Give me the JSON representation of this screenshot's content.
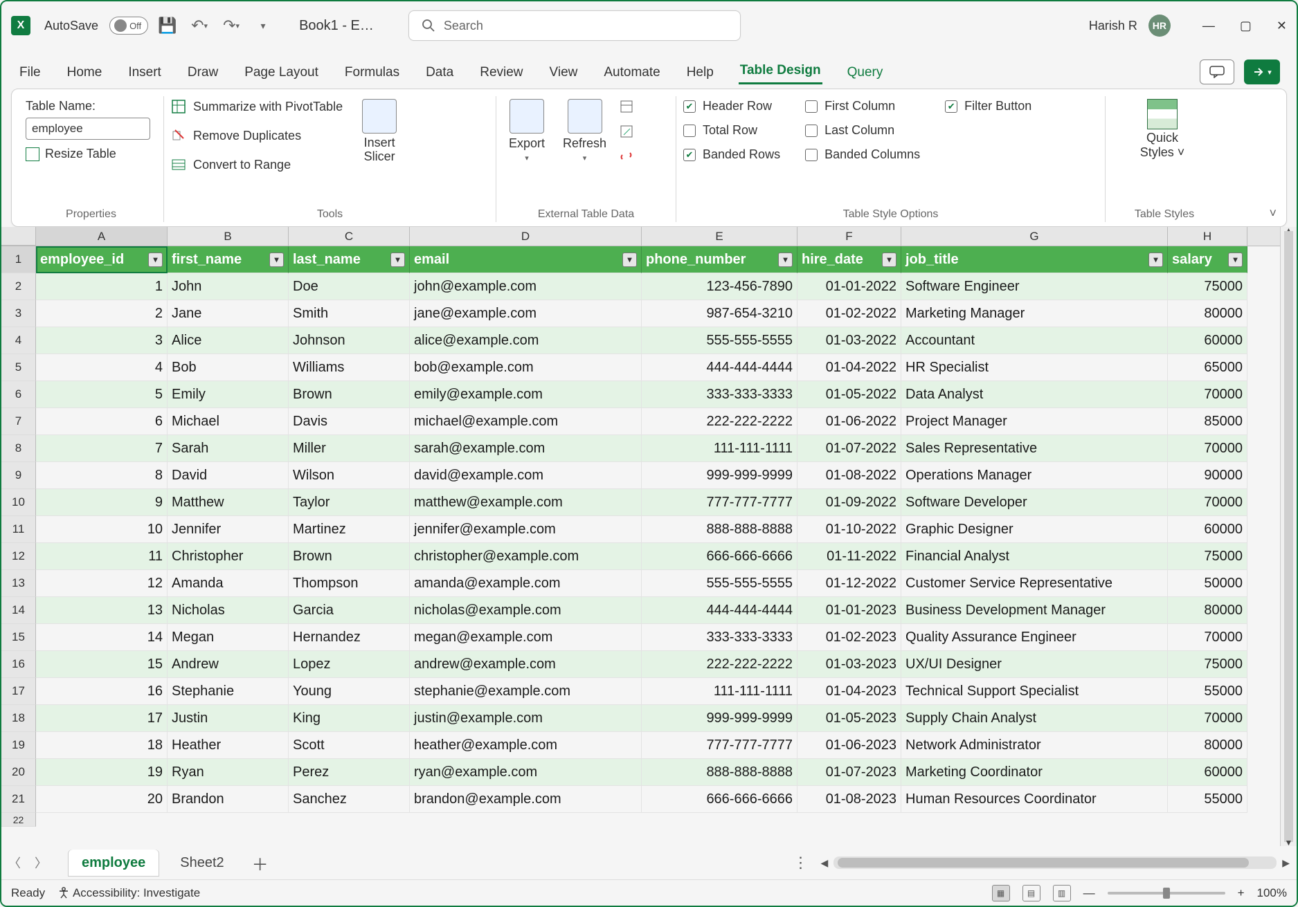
{
  "titlebar": {
    "autosave_label": "AutoSave",
    "autosave_state": "Off",
    "book_title": "Book1  -  E…",
    "search_placeholder": "Search",
    "user_name": "Harish R",
    "user_initials": "HR"
  },
  "tabs": {
    "items": [
      "File",
      "Home",
      "Insert",
      "Draw",
      "Page Layout",
      "Formulas",
      "Data",
      "Review",
      "View",
      "Automate",
      "Help",
      "Table Design",
      "Query"
    ],
    "active": "Table Design"
  },
  "ribbon": {
    "properties": {
      "table_name_label": "Table Name:",
      "table_name_value": "employee",
      "resize_table": "Resize Table",
      "group_label": "Properties"
    },
    "tools": {
      "summarize": "Summarize with PivotTable",
      "remove_dup": "Remove Duplicates",
      "convert_range": "Convert to Range",
      "insert_slicer": "Insert Slicer",
      "group_label": "Tools"
    },
    "external": {
      "export": "Export",
      "refresh": "Refresh",
      "group_label": "External Table Data"
    },
    "style_options": {
      "header_row": "Header Row",
      "total_row": "Total Row",
      "banded_rows": "Banded Rows",
      "first_column": "First Column",
      "last_column": "Last Column",
      "banded_columns": "Banded Columns",
      "filter_button": "Filter Button",
      "group_label": "Table Style Options"
    },
    "styles": {
      "quick_styles": "Quick Styles",
      "group_label": "Table Styles"
    }
  },
  "columns": [
    "A",
    "B",
    "C",
    "D",
    "E",
    "F",
    "G",
    "H"
  ],
  "table_headers": [
    "employee_id",
    "first_name",
    "last_name",
    "email",
    "phone_number",
    "hire_date",
    "job_title",
    "salary"
  ],
  "table_rows": [
    {
      "id": 1,
      "fn": "John",
      "ln": "Doe",
      "em": "john@example.com",
      "ph": "123-456-7890",
      "hd": "01-01-2022",
      "jt": "Software Engineer",
      "sl": 75000
    },
    {
      "id": 2,
      "fn": "Jane",
      "ln": "Smith",
      "em": "jane@example.com",
      "ph": "987-654-3210",
      "hd": "01-02-2022",
      "jt": "Marketing Manager",
      "sl": 80000
    },
    {
      "id": 3,
      "fn": "Alice",
      "ln": "Johnson",
      "em": "alice@example.com",
      "ph": "555-555-5555",
      "hd": "01-03-2022",
      "jt": "Accountant",
      "sl": 60000
    },
    {
      "id": 4,
      "fn": "Bob",
      "ln": "Williams",
      "em": "bob@example.com",
      "ph": "444-444-4444",
      "hd": "01-04-2022",
      "jt": "HR Specialist",
      "sl": 65000
    },
    {
      "id": 5,
      "fn": "Emily",
      "ln": "Brown",
      "em": "emily@example.com",
      "ph": "333-333-3333",
      "hd": "01-05-2022",
      "jt": "Data Analyst",
      "sl": 70000
    },
    {
      "id": 6,
      "fn": "Michael",
      "ln": "Davis",
      "em": "michael@example.com",
      "ph": "222-222-2222",
      "hd": "01-06-2022",
      "jt": "Project Manager",
      "sl": 85000
    },
    {
      "id": 7,
      "fn": "Sarah",
      "ln": "Miller",
      "em": "sarah@example.com",
      "ph": "111-111-1111",
      "hd": "01-07-2022",
      "jt": "Sales Representative",
      "sl": 70000
    },
    {
      "id": 8,
      "fn": "David",
      "ln": "Wilson",
      "em": "david@example.com",
      "ph": "999-999-9999",
      "hd": "01-08-2022",
      "jt": "Operations Manager",
      "sl": 90000
    },
    {
      "id": 9,
      "fn": "Matthew",
      "ln": "Taylor",
      "em": "matthew@example.com",
      "ph": "777-777-7777",
      "hd": "01-09-2022",
      "jt": "Software Developer",
      "sl": 70000
    },
    {
      "id": 10,
      "fn": "Jennifer",
      "ln": "Martinez",
      "em": "jennifer@example.com",
      "ph": "888-888-8888",
      "hd": "01-10-2022",
      "jt": "Graphic Designer",
      "sl": 60000
    },
    {
      "id": 11,
      "fn": "Christopher",
      "ln": "Brown",
      "em": "christopher@example.com",
      "ph": "666-666-6666",
      "hd": "01-11-2022",
      "jt": "Financial Analyst",
      "sl": 75000
    },
    {
      "id": 12,
      "fn": "Amanda",
      "ln": "Thompson",
      "em": "amanda@example.com",
      "ph": "555-555-5555",
      "hd": "01-12-2022",
      "jt": "Customer Service Representative",
      "sl": 50000
    },
    {
      "id": 13,
      "fn": "Nicholas",
      "ln": "Garcia",
      "em": "nicholas@example.com",
      "ph": "444-444-4444",
      "hd": "01-01-2023",
      "jt": "Business Development Manager",
      "sl": 80000
    },
    {
      "id": 14,
      "fn": "Megan",
      "ln": "Hernandez",
      "em": "megan@example.com",
      "ph": "333-333-3333",
      "hd": "01-02-2023",
      "jt": "Quality Assurance Engineer",
      "sl": 70000
    },
    {
      "id": 15,
      "fn": "Andrew",
      "ln": "Lopez",
      "em": "andrew@example.com",
      "ph": "222-222-2222",
      "hd": "01-03-2023",
      "jt": "UX/UI Designer",
      "sl": 75000
    },
    {
      "id": 16,
      "fn": "Stephanie",
      "ln": "Young",
      "em": "stephanie@example.com",
      "ph": "111-111-1111",
      "hd": "01-04-2023",
      "jt": "Technical Support Specialist",
      "sl": 55000
    },
    {
      "id": 17,
      "fn": "Justin",
      "ln": "King",
      "em": "justin@example.com",
      "ph": "999-999-9999",
      "hd": "01-05-2023",
      "jt": "Supply Chain Analyst",
      "sl": 70000
    },
    {
      "id": 18,
      "fn": "Heather",
      "ln": "Scott",
      "em": "heather@example.com",
      "ph": "777-777-7777",
      "hd": "01-06-2023",
      "jt": "Network Administrator",
      "sl": 80000
    },
    {
      "id": 19,
      "fn": "Ryan",
      "ln": "Perez",
      "em": "ryan@example.com",
      "ph": "888-888-8888",
      "hd": "01-07-2023",
      "jt": "Marketing Coordinator",
      "sl": 60000
    },
    {
      "id": 20,
      "fn": "Brandon",
      "ln": "Sanchez",
      "em": "brandon@example.com",
      "ph": "666-666-6666",
      "hd": "01-08-2023",
      "jt": "Human Resources Coordinator",
      "sl": 55000
    }
  ],
  "sheets": {
    "active": "employee",
    "others": [
      "Sheet2"
    ]
  },
  "status": {
    "ready": "Ready",
    "accessibility": "Accessibility: Investigate",
    "zoom": "100%"
  }
}
